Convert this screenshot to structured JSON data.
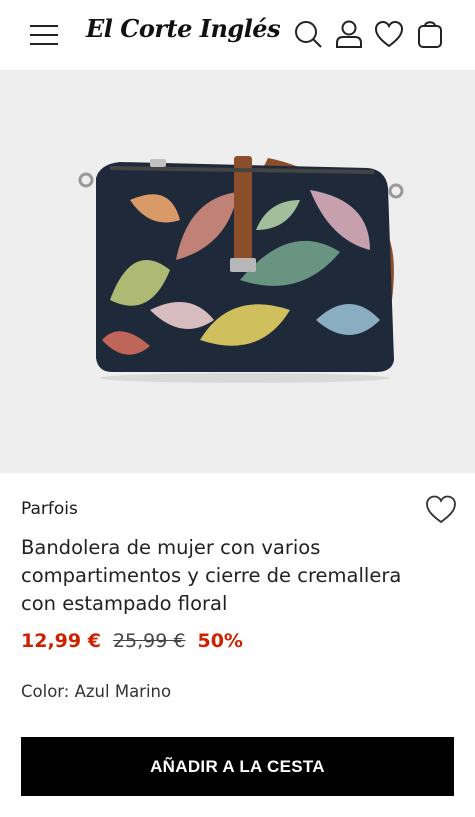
{
  "header": {
    "logo": "El Corte Inglés",
    "icons": [
      "menu-icon",
      "search-icon",
      "user-icon",
      "heart-icon",
      "bag-icon"
    ]
  },
  "gallery": {
    "progress": 0.25
  },
  "product": {
    "brand": "Parfois",
    "title": "Bandolera de mujer con varios compartimentos y cierre de cremallera con estampado floral",
    "price": "12,99 €",
    "original_price": "25,99 €",
    "discount": "50%",
    "color_text": "Color: Azul Marino"
  },
  "cta": {
    "add_to_cart": "AÑADIR A LA CESTA"
  },
  "colors": {
    "sale": "#cc2200",
    "button_bg": "#000000",
    "image_bg": "#eeeeee"
  }
}
